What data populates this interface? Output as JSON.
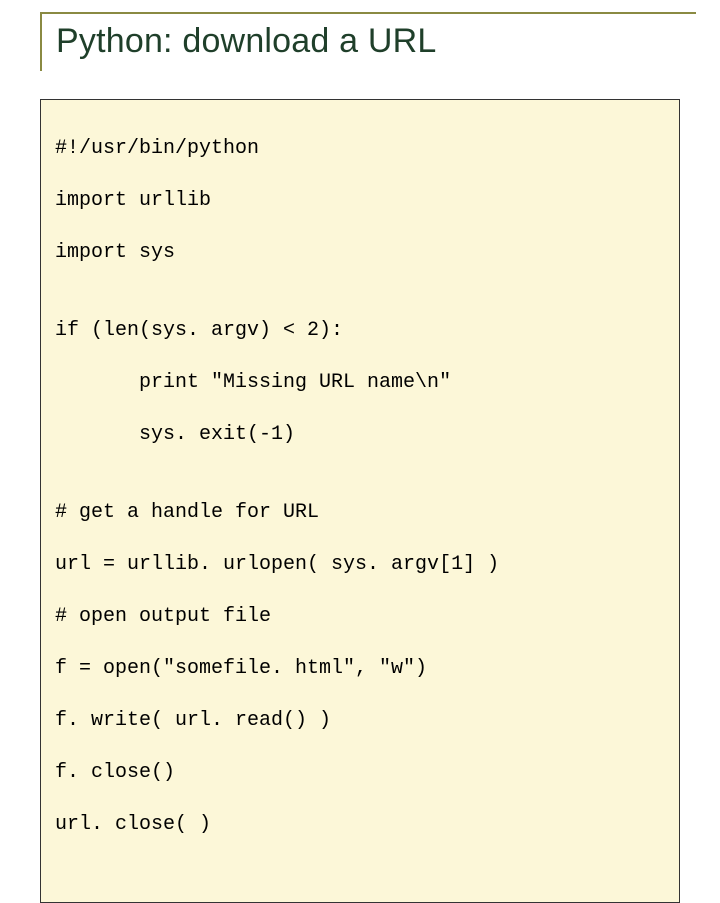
{
  "title": "Python: download a URL",
  "code": {
    "l01": "#!/usr/bin/python",
    "l02": "import urllib",
    "l03": "import sys",
    "l04": "if (len(sys. argv) < 2):",
    "l05": "       print \"Missing URL name\\n\"",
    "l06": "       sys. exit(-1)",
    "l07": "# get a handle for URL",
    "l08": "url = urllib. urlopen( sys. argv[1] )",
    "l09": "# open output file",
    "l10": "f = open(\"somefile. html\", \"w\")",
    "l11": "f. write( url. read() )",
    "l12": "f. close()",
    "l13": "url. close( )"
  }
}
